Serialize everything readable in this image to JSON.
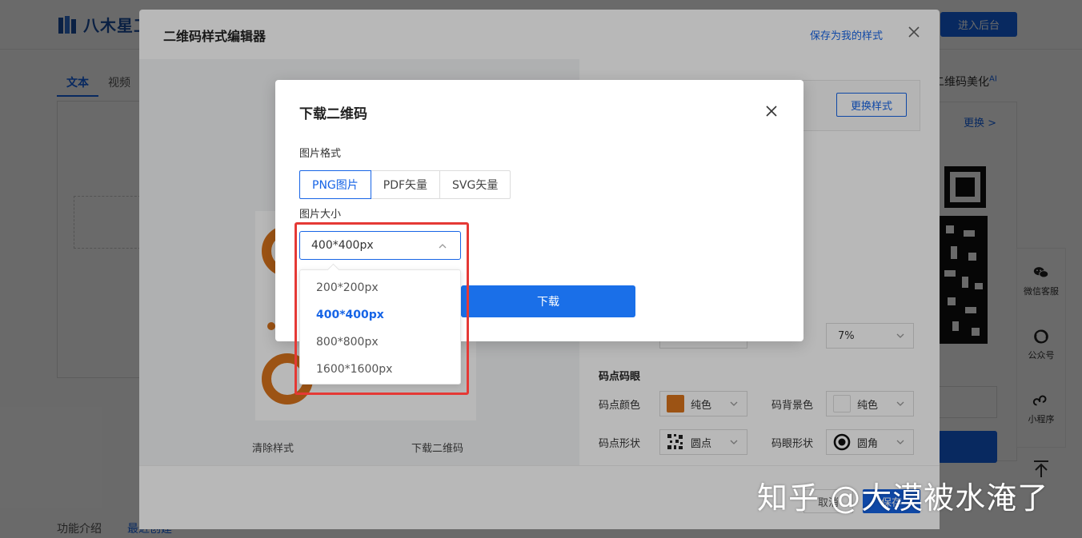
{
  "site": {
    "logo_text": "八木星工",
    "admin_button": "进入后台",
    "tabs": [
      "文本",
      "视频"
    ],
    "footer_links": [
      "功能介绍",
      "最近创建"
    ],
    "beautify_title": "二维码美化",
    "beautify_badge": "AI",
    "change_link": "更换 >",
    "side_tools": [
      "微信客服",
      "公众号",
      "小程序"
    ]
  },
  "editor_modal": {
    "title": "二维码样式编辑器",
    "save_as_mine": "保存为我的样式",
    "change_style_button": "更换样式",
    "clear_style": "清除样式",
    "download_qr": "下载二维码",
    "margin_value": "7%",
    "section_title": "码点码眼",
    "labels": {
      "dot_color": "码点颜色",
      "bg_color": "码背景色",
      "dot_shape": "码点形状",
      "eye_shape": "码眼形状"
    },
    "values": {
      "dot_color": "纯色",
      "bg_color": "纯色",
      "dot_shape": "圆点",
      "eye_shape": "圆角"
    },
    "colors": {
      "dot_color": "#d9731c",
      "bg_color": "#ffffff"
    },
    "cancel_button": "取消",
    "confirm_button": "保存"
  },
  "download_dialog": {
    "title": "下载二维码",
    "format_label": "图片格式",
    "formats": [
      "PNG图片",
      "PDF矢量",
      "SVG矢量"
    ],
    "selected_format": "PNG图片",
    "size_label": "图片大小",
    "selected_size": "400*400px",
    "size_options": [
      "200*200px",
      "400*400px",
      "800*800px",
      "1600*1600px"
    ],
    "download_button": "下载"
  },
  "watermark": "知乎 @大漠被水淹了",
  "colors": {
    "accent": "#1664e6",
    "highlight": "#e53935"
  }
}
